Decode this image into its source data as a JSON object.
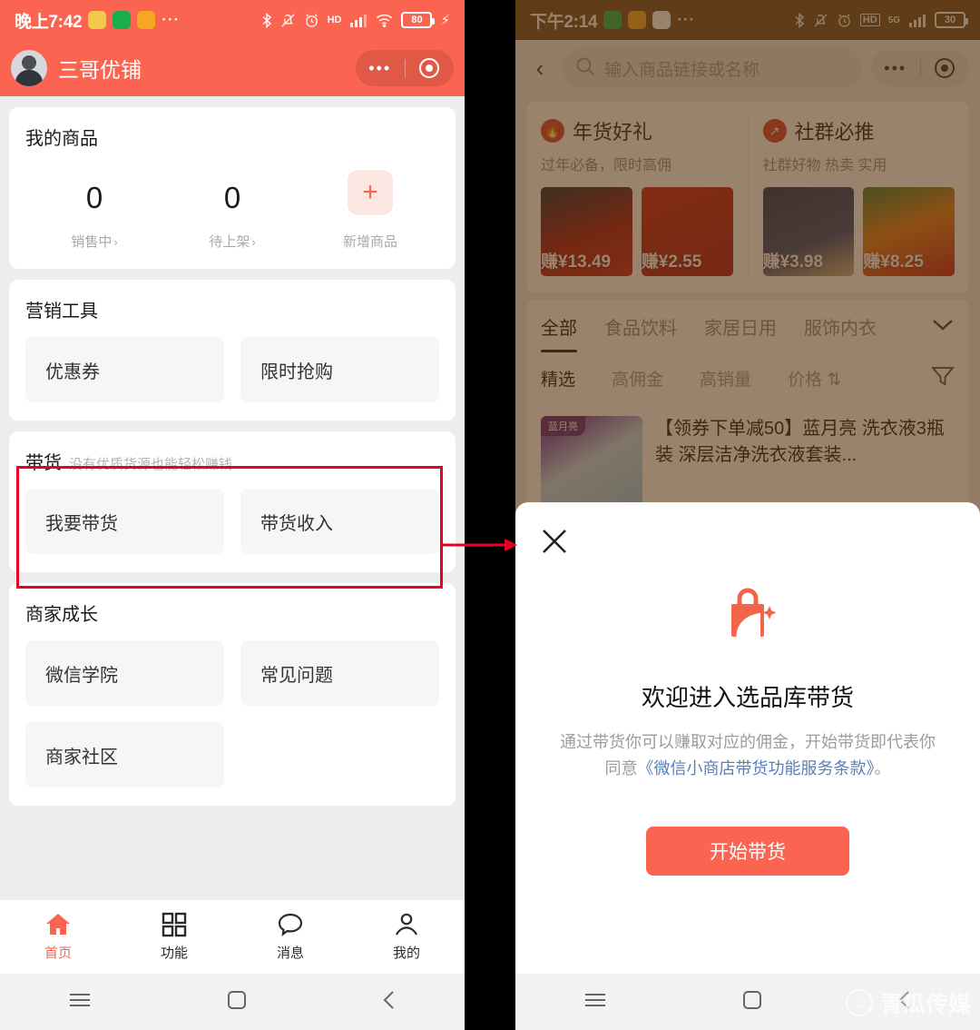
{
  "left": {
    "status": {
      "time": "晚上7:42",
      "dots": "···",
      "battery": "80",
      "net": "HD"
    },
    "header": {
      "shop_name": "三哥优铺",
      "capsule_dots": "•••"
    },
    "my_products": {
      "title": "我的商品",
      "stats": [
        {
          "num": "0",
          "label": "销售中",
          "chevron": "›"
        },
        {
          "num": "0",
          "label": "待上架",
          "chevron": "›"
        }
      ],
      "add": {
        "icon": "+",
        "label": "新增商品"
      }
    },
    "marketing": {
      "title": "营销工具",
      "tiles": [
        "优惠券",
        "限时抢购"
      ]
    },
    "daihuo": {
      "title": "带货",
      "subtitle": "没有优质货源也能轻松赚钱",
      "tiles": [
        "我要带货",
        "带货收入"
      ]
    },
    "growth": {
      "title": "商家成长",
      "tiles": [
        "微信学院",
        "常见问题",
        "商家社区"
      ]
    },
    "tabbar": [
      {
        "label": "首页",
        "icon": "home-icon",
        "active": true
      },
      {
        "label": "功能",
        "icon": "grid-icon",
        "active": false
      },
      {
        "label": "消息",
        "icon": "chat-icon",
        "active": false
      },
      {
        "label": "我的",
        "icon": "person-icon",
        "active": false
      }
    ]
  },
  "right": {
    "status": {
      "time": "下午2:14",
      "dots": "···",
      "battery": "30",
      "net": "HD",
      "gen": "5G"
    },
    "header": {
      "back": "‹",
      "search_placeholder": "输入商品链接或名称",
      "capsule_dots": "•••"
    },
    "promos": [
      {
        "title": "年货好礼",
        "subtitle": "过年必备，限时高佣",
        "icon": "flame-icon",
        "items": [
          {
            "earn": "赚¥13.49"
          },
          {
            "earn": "赚¥2.55"
          }
        ]
      },
      {
        "title": "社群必推",
        "subtitle": "社群好物 热卖 实用",
        "icon": "share-bag-icon",
        "items": [
          {
            "earn": "赚¥3.98"
          },
          {
            "earn": "赚¥8.25"
          }
        ]
      }
    ],
    "categories": [
      "全部",
      "食品饮料",
      "家居日用",
      "服饰内衣"
    ],
    "category_active": "全部",
    "sorts": [
      "精选",
      "高佣金",
      "高销量",
      "价格 ⇅"
    ],
    "sort_active": "精选",
    "product": {
      "brand": "蓝月亮",
      "title": "【领券下单减50】蓝月亮 洗衣液3瓶装 深层洁净洗衣液套装..."
    },
    "sheet": {
      "close": "✕",
      "icon": "shopping-bag-sparkle-icon",
      "title": "欢迎进入选品库带货",
      "desc_before": "通过带货你可以赚取对应的佣金，开始带货即代表你同意",
      "desc_link": "《微信小商店带货功能服务条款》",
      "desc_after": "。",
      "cta": "开始带货"
    },
    "watermark": "青瓜传媒"
  },
  "colors": {
    "brand": "#fa6450",
    "annotation": "#e60023",
    "link": "#5a7fb5",
    "overlay": "#6b4423"
  }
}
